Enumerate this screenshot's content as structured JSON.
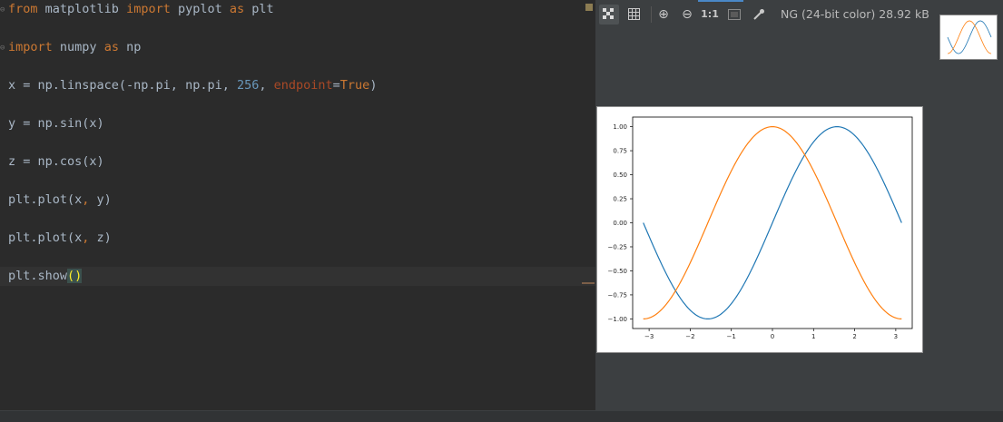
{
  "editor": {
    "lines": [
      [
        {
          "t": "from",
          "c": "kw"
        },
        {
          "t": " matplotlib "
        },
        {
          "t": "import",
          "c": "kw"
        },
        {
          "t": " pyplot "
        },
        {
          "t": "as",
          "c": "kw"
        },
        {
          "t": " plt"
        }
      ],
      [
        {
          "t": "import",
          "c": "kw"
        },
        {
          "t": " numpy "
        },
        {
          "t": "as",
          "c": "kw"
        },
        {
          "t": " np"
        }
      ],
      [
        {
          "t": "x = np.linspace(-np.pi, np.pi, "
        },
        {
          "t": "256",
          "c": "num"
        },
        {
          "t": ", "
        },
        {
          "t": "endpoint",
          "c": "param"
        },
        {
          "t": "="
        },
        {
          "t": "True",
          "c": "lit"
        },
        {
          "t": ")"
        }
      ],
      [
        {
          "t": "y = np.sin(x)"
        }
      ],
      [
        {
          "t": "z = np.cos(x)"
        }
      ],
      [
        {
          "t": "plt.plot(x"
        },
        {
          "t": ",",
          "c": "kw"
        },
        {
          "t": " y)"
        }
      ],
      [
        {
          "t": "plt.plot(x"
        },
        {
          "t": ",",
          "c": "kw"
        },
        {
          "t": " z)"
        }
      ],
      [
        {
          "t": "plt.show"
        },
        {
          "t": "()",
          "c": "brace"
        }
      ]
    ]
  },
  "viewer": {
    "toolbar": {
      "chessboard_icon": "chessboard-icon",
      "grid_icon": "grid-icon",
      "zoom_in_icon": "zoom-in-icon",
      "zoom_out_icon": "zoom-out-icon",
      "actual_size_label": "1:1",
      "fit_icon": "fit-icon",
      "color_picker_icon": "eyedropper-icon"
    },
    "info_text": "NG (24-bit color) 28.92 kB"
  },
  "chart_data": {
    "type": "line",
    "title": "",
    "xlabel": "",
    "ylabel": "",
    "xlim": [
      -3.4,
      3.4
    ],
    "ylim": [
      -1.1,
      1.1
    ],
    "xticks": [
      -3,
      -2,
      -1,
      0,
      1,
      2,
      3
    ],
    "xtick_labels": [
      "−3",
      "−2",
      "−1",
      "0",
      "1",
      "2",
      "3"
    ],
    "yticks": [
      1.0,
      0.75,
      0.5,
      0.25,
      0.0,
      -0.25,
      -0.5,
      -0.75,
      -1.0
    ],
    "ytick_labels": [
      "1.00",
      "0.75",
      "0.50",
      "0.25",
      "0.00",
      "−0.25",
      "−0.50",
      "−0.75",
      "−1.00"
    ],
    "grid": false,
    "series": [
      {
        "function": "sin(x)",
        "color": "#1f77b4",
        "x": [
          -3.1416,
          -2.3562,
          -1.5708,
          -0.7854,
          0,
          0.7854,
          1.5708,
          2.3562,
          3.1416
        ],
        "y": [
          0,
          -0.7071,
          -1,
          -0.7071,
          0,
          0.7071,
          1,
          0.7071,
          0
        ]
      },
      {
        "function": "cos(x)",
        "color": "#ff7f0e",
        "x": [
          -3.1416,
          -2.3562,
          -1.5708,
          -0.7854,
          0,
          0.7854,
          1.5708,
          2.3562,
          3.1416
        ],
        "y": [
          -1,
          -0.7071,
          0,
          0.7071,
          1,
          0.7071,
          0,
          -0.7071,
          -1
        ]
      }
    ]
  }
}
